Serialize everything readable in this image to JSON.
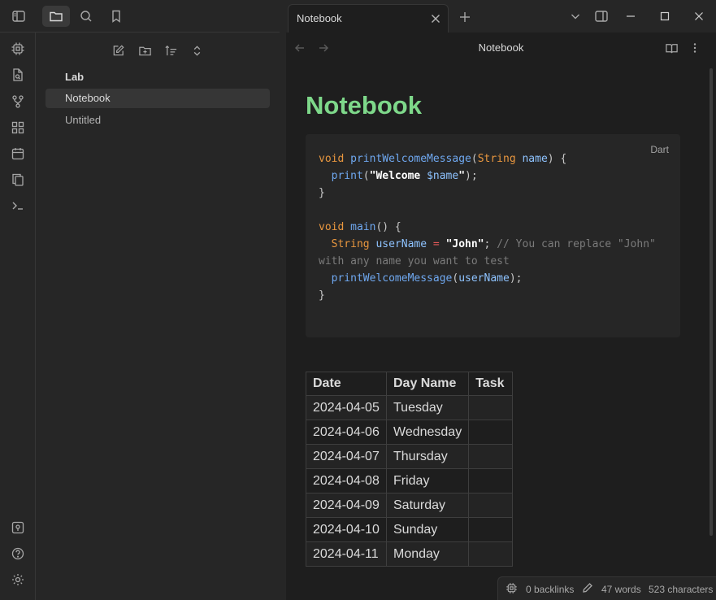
{
  "sidebar": {
    "vault_name": "Lab",
    "files": [
      {
        "label": "Notebook",
        "active": true
      },
      {
        "label": "Untitled",
        "active": false
      }
    ]
  },
  "tab": {
    "title": "Notebook"
  },
  "view_header": {
    "title": "Notebook"
  },
  "document": {
    "title": "Notebook",
    "code_language": "Dart",
    "table": {
      "headers": [
        "Date",
        "Day Name",
        "Task"
      ],
      "rows": [
        [
          "2024-04-05",
          "Tuesday",
          ""
        ],
        [
          "2024-04-06",
          "Wednesday",
          ""
        ],
        [
          "2024-04-07",
          "Thursday",
          ""
        ],
        [
          "2024-04-08",
          "Friday",
          ""
        ],
        [
          "2024-04-09",
          "Saturday",
          ""
        ],
        [
          "2024-04-10",
          "Sunday",
          ""
        ],
        [
          "2024-04-11",
          "Monday",
          ""
        ]
      ]
    }
  },
  "status": {
    "backlinks": "0 backlinks",
    "words": "47 words",
    "characters": "523 characters"
  },
  "colors": {
    "title_green": "#7ed88a",
    "keyword_orange": "#e9973f",
    "function_blue": "#6fa8f0"
  }
}
